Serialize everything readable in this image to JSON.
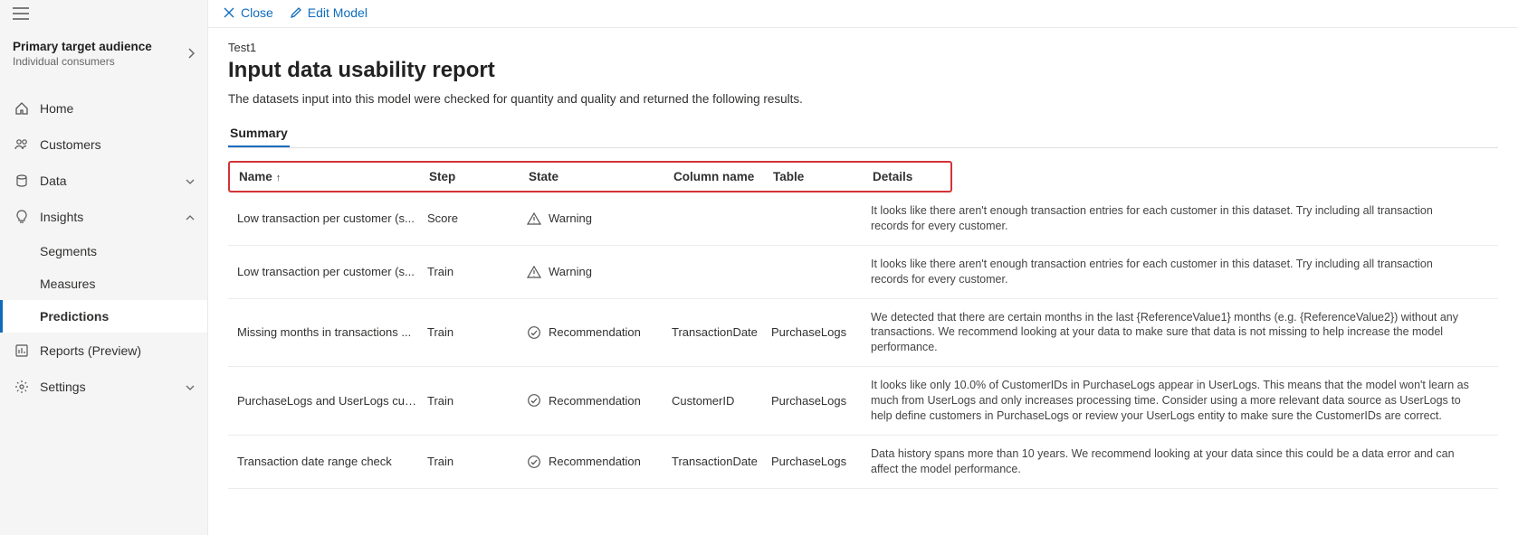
{
  "sidebar": {
    "audience": {
      "title": "Primary target audience",
      "subtitle": "Individual consumers"
    },
    "items": {
      "home": "Home",
      "customers": "Customers",
      "data": "Data",
      "insights": "Insights",
      "segments": "Segments",
      "measures": "Measures",
      "predictions": "Predictions",
      "reports": "Reports (Preview)",
      "settings": "Settings"
    }
  },
  "cmd": {
    "close": "Close",
    "edit": "Edit Model"
  },
  "page": {
    "breadcrumb": "Test1",
    "title": "Input data usability report",
    "desc": "The datasets input into this model were checked for quantity and quality and returned the following results.",
    "tab": "Summary"
  },
  "table": {
    "headers": {
      "name": "Name",
      "step": "Step",
      "state": "State",
      "column": "Column name",
      "table": "Table",
      "details": "Details"
    },
    "rows": [
      {
        "name": "Low transaction per customer (s...",
        "step": "Score",
        "state": "Warning",
        "state_icon": "warning",
        "column": "",
        "table": "",
        "details": "It looks like there aren't enough transaction entries for each customer in this dataset. Try including all transaction records for every customer."
      },
      {
        "name": "Low transaction per customer (s...",
        "step": "Train",
        "state": "Warning",
        "state_icon": "warning",
        "column": "",
        "table": "",
        "details": "It looks like there aren't enough transaction entries for each customer in this dataset. Try including all transaction records for every customer."
      },
      {
        "name": "Missing months in transactions ...",
        "step": "Train",
        "state": "Recommendation",
        "state_icon": "check",
        "column": "TransactionDate",
        "table": "PurchaseLogs",
        "details": "We detected that there are certain months in the last {ReferenceValue1} months (e.g. {ReferenceValue2}) without any transactions. We recommend looking at your data to make sure that data is not missing to help increase the model performance."
      },
      {
        "name": "PurchaseLogs and UserLogs cus...",
        "step": "Train",
        "state": "Recommendation",
        "state_icon": "check",
        "column": "CustomerID",
        "table": "PurchaseLogs",
        "details": "It looks like only 10.0% of CustomerIDs in PurchaseLogs appear in UserLogs. This means that the model won't learn as much from UserLogs and only increases processing time. Consider using a more relevant data source as UserLogs to help define customers in PurchaseLogs or review your UserLogs entity to make sure the CustomerIDs are correct."
      },
      {
        "name": "Transaction date range check",
        "step": "Train",
        "state": "Recommendation",
        "state_icon": "check",
        "column": "TransactionDate",
        "table": "PurchaseLogs",
        "details": "Data history spans more than 10 years. We recommend looking at your data since this could be a data error and can affect the model performance."
      }
    ]
  }
}
